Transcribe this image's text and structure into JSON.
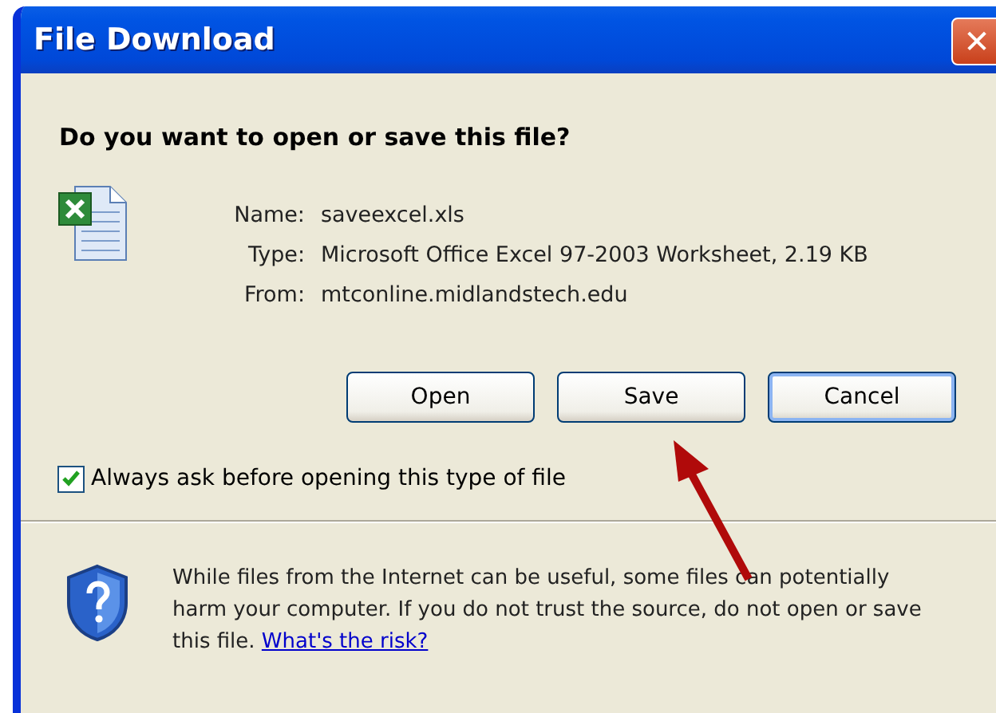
{
  "window": {
    "title": "File Download",
    "close": "✕"
  },
  "question": "Do you want to open or save this file?",
  "details": [
    {
      "label": "Name:",
      "value": "saveexcel.xls"
    },
    {
      "label": "Type:",
      "value": "Microsoft Office Excel 97-2003 Worksheet, 2.19 KB"
    },
    {
      "label": "From:",
      "value": "mtconline.midlandstech.edu"
    }
  ],
  "buttons": [
    {
      "label": "Open",
      "focused": false
    },
    {
      "label": "Save",
      "focused": false
    },
    {
      "label": "Cancel",
      "focused": true
    }
  ],
  "always_ask": {
    "label": "Always ask before opening this type of file",
    "checked": true
  },
  "warning": {
    "text": "While files from the Internet can be useful, some files can potentially harm your computer. If you do not trust the source, do not open or save this file.",
    "link": "What's the risk?"
  }
}
